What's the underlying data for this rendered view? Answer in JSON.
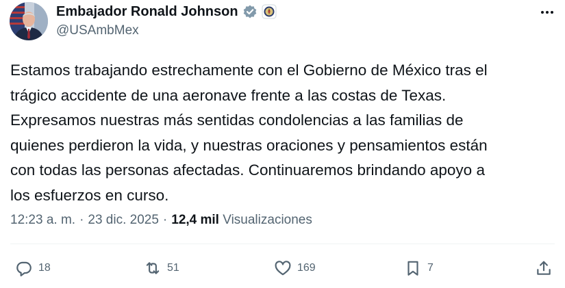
{
  "author": {
    "display_name": "Embajador Ronald Johnson",
    "handle": "@USAmbMex",
    "verified_badge_color": "#829aab",
    "affiliate_badge": "seal-icon"
  },
  "tweet": {
    "text": "Estamos trabajando estrechamente con el Gobierno de México tras el\ntrágico accidente de una aeronave frente a las costas de Texas.\nExpresamos nuestras más sentidas condolencias a las familias de\nquienes perdieron la vida, y nuestras oraciones y pensamientos están\ncon todas las personas afectadas. Continuaremos brindando apoyo a\nlos esfuerzos en curso."
  },
  "meta": {
    "time": "12:23 a. m.",
    "separator": "·",
    "date": "23 dic. 2025",
    "views_count": "12,4 mil",
    "views_label": "Visualizaciones"
  },
  "actions": {
    "replies": "18",
    "reposts": "51",
    "likes": "169",
    "bookmarks": "7"
  },
  "colors": {
    "text_primary": "#0f1419",
    "text_secondary": "#536471",
    "divider": "#eff3f4"
  }
}
